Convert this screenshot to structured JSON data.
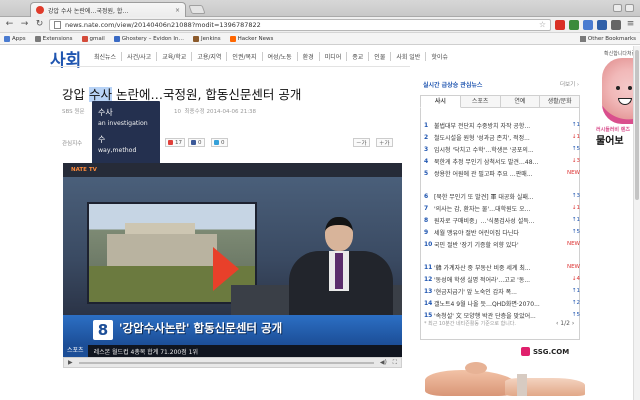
{
  "browser": {
    "tab_title": "강압 수사 논란에…국정원, 합…",
    "tab_close": "×",
    "url": "news.nate.com/view/20140406n21088?modit=1396787822",
    "bookmarks": [
      {
        "label": "Apps",
        "color": "#4a7bd0"
      },
      {
        "label": "Extensions",
        "color": "#7a7a7a"
      },
      {
        "label": "gmail",
        "color": "#d44b3a"
      },
      {
        "label": "Ghostery – Evidon In…",
        "color": "#3a6ac4"
      },
      {
        "label": "Jenkins",
        "color": "#8c5a2b"
      },
      {
        "label": "Hacker News",
        "color": "#ff6600"
      }
    ],
    "other_bookmarks": "Other Bookmarks"
  },
  "site": {
    "logo": "사회",
    "nav": [
      "최신뉴스",
      "사건/사고",
      "교육/학교",
      "고용/지역",
      "인권/복지",
      "여성/노동",
      "환경",
      "미디어",
      "종교",
      "인물",
      "사회 일반",
      "핫이슈"
    ]
  },
  "article": {
    "title_pre": "강압 ",
    "title_highlight": "수사",
    "title_post": " 논란에…국정원, 합동신문센터 공개",
    "byline": "SBS 원문",
    "dateline_id": "10",
    "dateline": "최종수정 2014-04-06 21:38",
    "share_label": "관심지수",
    "share_count_1": "17",
    "share_count_2": "0",
    "share_count_3": "0",
    "font_minus": "－가",
    "font_plus": "＋가"
  },
  "tooltip": {
    "word1": "수사",
    "meaning1": "an investigation",
    "word2": "수",
    "meaning2": "way,method"
  },
  "video": {
    "brand": "NATE TV",
    "channel": "8",
    "caption": "'강압수사논란' 합동신문센터 공개",
    "ticker_label": "스포츠",
    "ticker_text": "레스본 월드컵 4총목 합계 71.200점 1위"
  },
  "trend": {
    "title": "실시간 급상승 관심뉴스",
    "more": "더보기 ›",
    "tabs": [
      "사시",
      "스포츠",
      "연예",
      "생활/문화"
    ],
    "items": [
      {
        "n": "1",
        "t": "불법대부 전단지 수중방치 자작 공항...",
        "c": "↑1",
        "k": "up"
      },
      {
        "n": "2",
        "t": "철도시설을 원형 '성과금 존치', 적정...",
        "c": "↓1",
        "k": "dn"
      },
      {
        "n": "3",
        "t": "임시청 '닥치고 수학'…학생은 '공포의...",
        "c": "↑5",
        "k": "up"
      },
      {
        "n": "4",
        "t": "북한게 추정 무인기 삼척서도 발견…48...",
        "c": "↓3",
        "k": "dn"
      },
      {
        "n": "5",
        "t": "쌍용한 어원에 관 필고파 주요 …판매...",
        "c": "NEW",
        "k": "nw"
      },
      {
        "n": "6",
        "t": "[북한 무인기 또 발견] 軍 대공화 실패...",
        "c": "↑3",
        "k": "up"
      },
      {
        "n": "7",
        "t": "'의사는 감, 환자는 물'…대학원도 오...",
        "c": "↓1",
        "k": "dn"
      },
      {
        "n": "8",
        "t": "원자로 구매비중」…'식품검사성 설득...",
        "c": "↑1",
        "k": "up"
      },
      {
        "n": "9",
        "t": "세월 맹유야 절반 어린이집 다닌다",
        "c": "↑5",
        "k": "up"
      },
      {
        "n": "10",
        "t": "국민 절반 '장기 기증할 의향 있다'",
        "c": "NEW",
        "k": "nw"
      },
      {
        "n": "11",
        "t": "'韓 가계자산 중 부동산 비중 세계 최...",
        "c": "NEW",
        "k": "nw"
      },
      {
        "n": "12",
        "t": "'동성애 학생 실명 적어라'…고교 '동...",
        "c": "↓4",
        "k": "dn"
      },
      {
        "n": "13",
        "t": "'현금지급기' 앞 노숙인 갑자 폭...",
        "c": "↑1",
        "k": "up"
      },
      {
        "n": "14",
        "t": "갤노트4 9월 나올 듯…QHD화면·2070...",
        "c": "↑2",
        "k": "up"
      },
      {
        "n": "15",
        "t": "'속청설' 文 모양행 박관 단층을 맞았어...",
        "c": "↑5",
        "k": "up"
      }
    ],
    "footer": "* 최근 10분간 네티즌활동 기준으로 합니다.",
    "page": "‹ 1/2 ›"
  },
  "ad": {
    "head": "확신합니다처럼",
    "small": "러시들러비 렌즈",
    "big": "물어보",
    "ssg": "SSG.COM"
  }
}
